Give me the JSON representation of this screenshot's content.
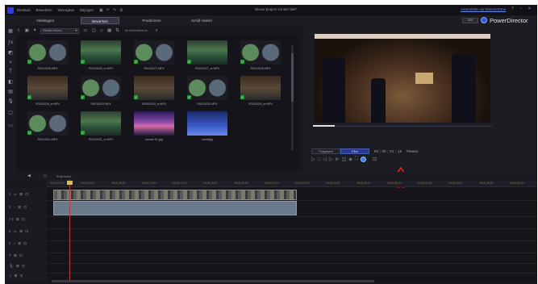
{
  "menubar": {
    "items": [
      "Bestand",
      "Bewerken",
      "Weergave",
      "Wijzigen"
    ],
    "project_title": "Nieuw project zonder titel*",
    "upgrade_link": "Aanmelden op DirectorZone"
  },
  "modes": {
    "tabs": [
      "Vastleggen",
      "Bewerken",
      "Produceren",
      "Schijf maken"
    ],
    "active": "Bewerken"
  },
  "brand": {
    "badge": "365",
    "name": "PowerDirector"
  },
  "library": {
    "filter_label": "Media-inhoud",
    "search_placeholder": "De bibliotheek do...",
    "items": [
      {
        "label": "R0010026.MP4",
        "kind": "orb",
        "checked": true
      },
      {
        "label": "R0010026_er.MP4",
        "kind": "pano",
        "checked": true
      },
      {
        "label": "R0010027.MP4",
        "kind": "orb",
        "checked": true
      },
      {
        "label": "R0010027_er.MP4",
        "kind": "pano",
        "checked": true
      },
      {
        "label": "R0010028.MP4",
        "kind": "orb",
        "checked": true
      },
      {
        "label": "R0010028_er.MP4",
        "kind": "bar",
        "checked": true
      },
      {
        "label": "R0010029.MP4",
        "kind": "orb",
        "checked": true
      },
      {
        "label": "R0010029_er.MP4",
        "kind": "bar",
        "checked": true
      },
      {
        "label": "R0010030.MP4",
        "kind": "orb",
        "checked": true
      },
      {
        "label": "R0010030_er.MP4",
        "kind": "bar",
        "checked": true
      },
      {
        "label": "R0010031.MP4",
        "kind": "orb",
        "checked": true
      },
      {
        "label": "R0010031_er.MP4",
        "kind": "pano",
        "checked": true
      },
      {
        "label": "sunset 01.jpg",
        "kind": "sunset",
        "checked": false
      },
      {
        "label": "nachtjpg",
        "kind": "night",
        "checked": false
      }
    ]
  },
  "preview": {
    "clip_toggle": "Fragment",
    "film_toggle": "Film",
    "active_toggle": "Film",
    "timecode": "00 ; 00 ; 01 ; 15",
    "quality": "Passen",
    "progress": 0.12
  },
  "timeline": {
    "track_label": "Snijmodus",
    "ruler_ticks": [
      "00;00;00;00",
      "00;00;03;10",
      "00;00;06;20",
      "00;00;10;00",
      "00;00;13;10",
      "00;00;16;20",
      "00;00;20;00",
      "00;00;23;10",
      "00;00;26;20",
      "00;00;30;00",
      "00;00;33;10",
      "00;00;36;20",
      "00;00;40;00",
      "00;00;43;10",
      "00;00;46;20",
      "00;00;50;00"
    ]
  },
  "colors": {
    "accent": "#2a3a8a",
    "annotation_arrow": "#e02020",
    "playhead": "#c03a3a"
  }
}
